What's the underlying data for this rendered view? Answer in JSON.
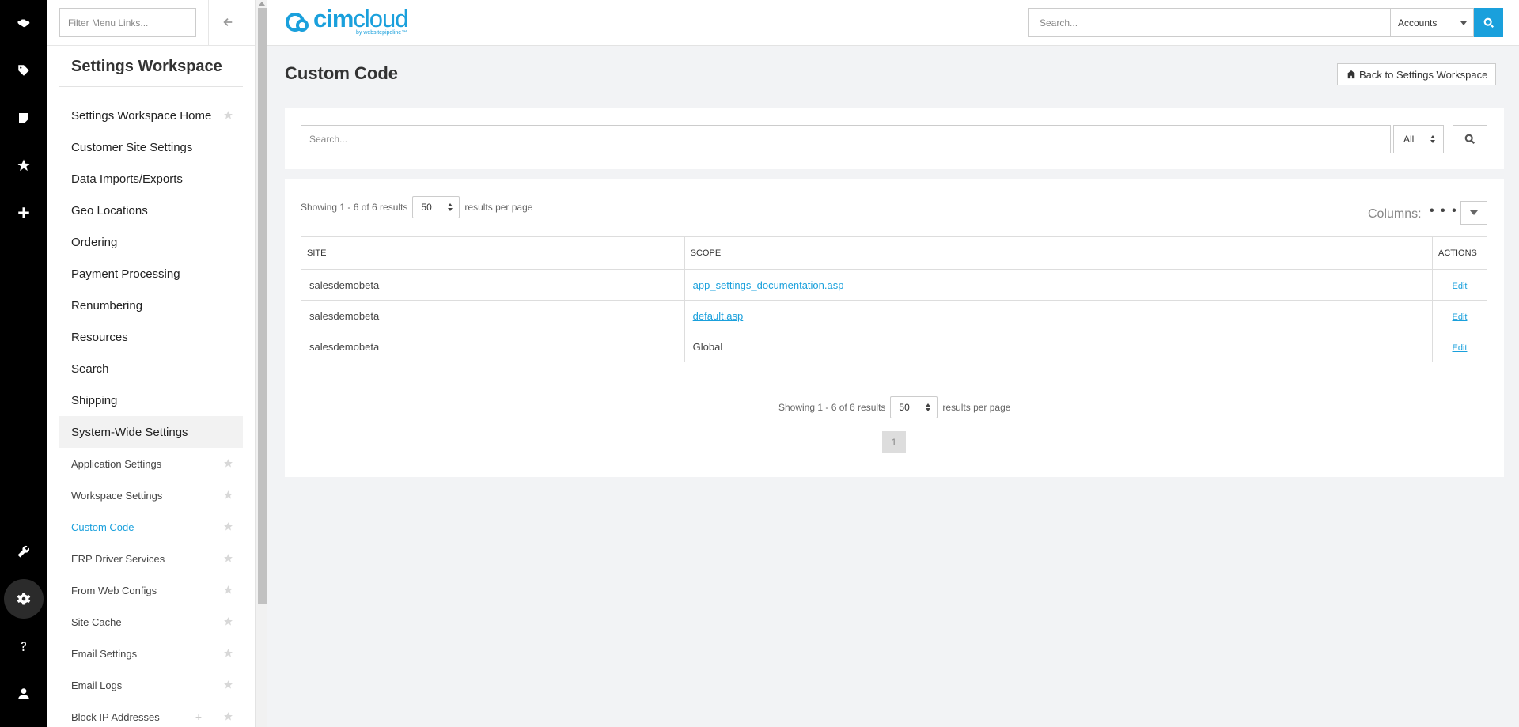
{
  "rail": {
    "icons": [
      "handshake-icon",
      "tag-icon",
      "note-icon",
      "star-icon",
      "plus-icon",
      "wrench-icon",
      "gear-icon",
      "question-icon",
      "user-icon"
    ]
  },
  "sidebar": {
    "filter_placeholder": "Filter Menu Links...",
    "title": "Settings Workspace",
    "items": [
      {
        "label": "Settings Workspace Home"
      },
      {
        "label": "Customer Site Settings"
      },
      {
        "label": "Data Imports/Exports"
      },
      {
        "label": "Geo Locations"
      },
      {
        "label": "Ordering"
      },
      {
        "label": "Payment Processing"
      },
      {
        "label": "Renumbering"
      },
      {
        "label": "Resources"
      },
      {
        "label": "Search"
      },
      {
        "label": "Shipping"
      },
      {
        "label": "System-Wide Settings"
      }
    ],
    "subitems": [
      {
        "label": "Application Settings"
      },
      {
        "label": "Workspace Settings"
      },
      {
        "label": "Custom Code"
      },
      {
        "label": "ERP Driver Services"
      },
      {
        "label": "From Web Configs"
      },
      {
        "label": "Site Cache"
      },
      {
        "label": "Email Settings"
      },
      {
        "label": "Email Logs"
      },
      {
        "label": "Block IP Addresses"
      }
    ]
  },
  "header": {
    "logo_text_bold": "cim",
    "logo_text_light": "cloud",
    "logo_sub": "by websitepipeline™",
    "search_placeholder": "Search...",
    "account_select": "Accounts"
  },
  "main": {
    "title": "Custom Code",
    "back_label": "Back to Settings Workspace",
    "search_placeholder": "Search...",
    "filter_select": "All",
    "showing_text": "Showing 1 - 6 of 6 results",
    "per_page": "50",
    "per_page_suffix": "results per page",
    "columns_label": "Columns:",
    "columns_dots": "• • •",
    "table": {
      "headers": [
        "Site",
        "Scope",
        "Actions"
      ],
      "rows": [
        {
          "site": "salesdemobeta",
          "scope": "app_settings_documentation.asp",
          "action": "Edit"
        },
        {
          "site": "salesdemobeta",
          "scope": "default.asp",
          "action": "Edit"
        },
        {
          "site": "salesdemobeta",
          "scope": "Global",
          "action": "Edit"
        }
      ]
    },
    "current_page": "1"
  },
  "colors": {
    "accent": "#1aa0dc",
    "rail_bg": "#000000"
  }
}
